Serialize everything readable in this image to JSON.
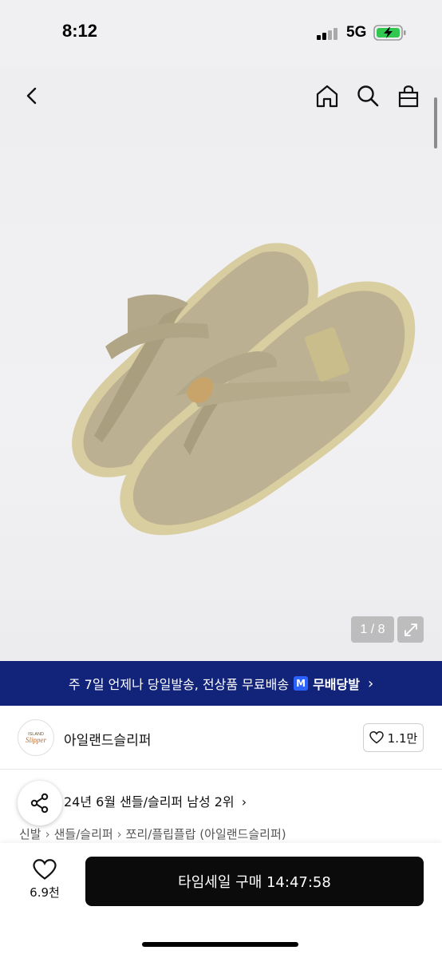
{
  "status": {
    "time": "8:12",
    "network": "5G",
    "battery_charging": true
  },
  "nav": {
    "back_icon": "chevron-left-icon",
    "home_icon": "home-icon",
    "search_icon": "search-icon",
    "cart_icon": "shopping-bag-icon"
  },
  "gallery": {
    "counter": "1 / 8",
    "expand_icon": "expand-arrows-icon"
  },
  "banner": {
    "text": "주 7일 언제나 당일발송, 전상품 무료배송",
    "badge": "M",
    "brand": "무배당발",
    "arrow": "›",
    "color": "#12237a"
  },
  "brand": {
    "logo_text": "ISLAND SLIPPER",
    "name": "아일랜드슬리퍼",
    "likes": "1.1만"
  },
  "ranking": {
    "text": "24년 6월 샌들/슬리퍼 남성 2위",
    "arrow": "›"
  },
  "breadcrumb": [
    "신발",
    "샌들/슬리퍼",
    "쪼리/플립플랍 (아일랜드슬리퍼)"
  ],
  "bottom": {
    "wish_count": "6.9천",
    "buy_label": "타임세일 구매 14:47:58"
  }
}
